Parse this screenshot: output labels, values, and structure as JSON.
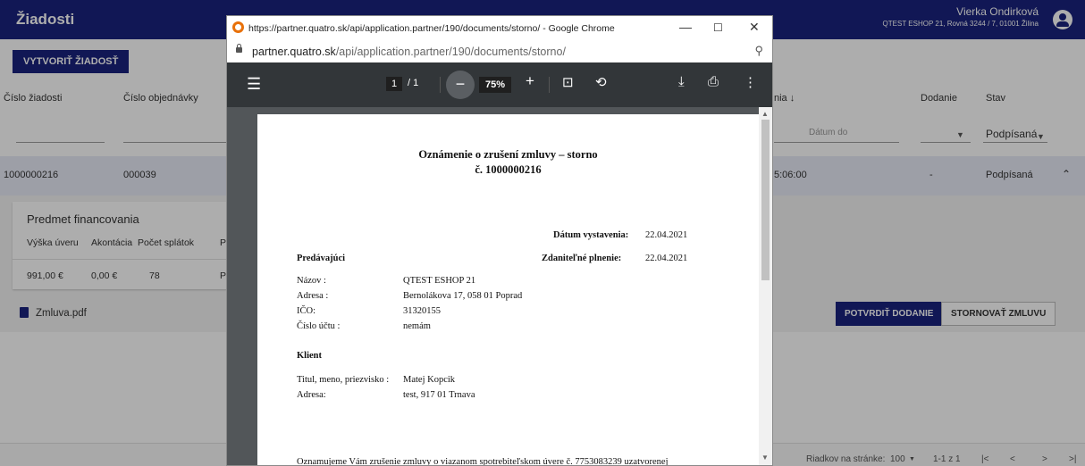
{
  "app": {
    "title": "Žiadosti",
    "user_name": "Vierka Ondirková",
    "user_company": "QTEST ESHOP 21, Rovná 3244 / 7, 01001 Žilina",
    "create_button": "VYTVORIŤ ŽIADOSŤ",
    "columns": {
      "cislo_ziadosti": "Číslo žiadosti",
      "cislo_objednavky": "Číslo objednávky",
      "datum_partial": "nia ↓",
      "dodanie": "Dodanie",
      "stav": "Stav"
    },
    "filters": {
      "datum_do_placeholder": "Dátum do",
      "stav_value": "Podpísaná"
    },
    "row": {
      "cislo_ziadosti": "1000000216",
      "cislo_objednavky": "000039",
      "time": "5:06:00",
      "dodanie": "-",
      "stav": "Podpísaná"
    },
    "financing": {
      "title": "Predmet financovania",
      "headers": [
        "Výška úveru",
        "Akontácia",
        "Počet splátok",
        "P"
      ],
      "values": [
        "991,00 €",
        "0,00 €",
        "78",
        "P"
      ]
    },
    "file_name": "Zmluva.pdf",
    "confirm_button": "POTVRDIŤ DODANIE",
    "cancel_button": "STORNOVAŤ ZMLUVU",
    "footer": {
      "rows_per_page_label": "Riadkov na stránke:",
      "rows_per_page_value": "100",
      "range": "1-1 z 1"
    }
  },
  "popup": {
    "window_title": "https://partner.quatro.sk/api/application.partner/190/documents/storno/ - Google Chrome",
    "address_host": "partner.quatro.sk",
    "address_path": "/api/application.partner/190/documents/storno/",
    "page_current": "1",
    "page_total": "/ 1",
    "zoom": "75%"
  },
  "document": {
    "title_line1": "Oznámenie o zrušení zmluvy – storno",
    "title_line2": "č. 1000000216",
    "issue_date_label": "Dátum vystavenia:",
    "issue_date_value": "22.04.2021",
    "seller_heading": "Predávajúci",
    "taxable_label": "Zdaniteľné plnenie:",
    "taxable_value": "22.04.2021",
    "seller": {
      "name_label": "Názov :",
      "name_value": "QTEST ESHOP 21",
      "address_label": "Adresa :",
      "address_value": "Bernolákova 17, 058 01 Poprad",
      "ico_label": "IČO:",
      "ico_value": "31320155",
      "account_label": "Číslo účtu :",
      "account_value": "nemám"
    },
    "client_heading": "Klient",
    "client": {
      "name_label": "Titul, meno, priezvisko :",
      "name_value": "Matej Kopcik",
      "address_label": "Adresa:",
      "address_value": "test, 917 01 Trnava"
    },
    "cut_text": "Oznamujeme Vám zrušenie zmluvy o viazanom spotrebiteľskom úvere č. 7753083239 uzatvorenej"
  }
}
